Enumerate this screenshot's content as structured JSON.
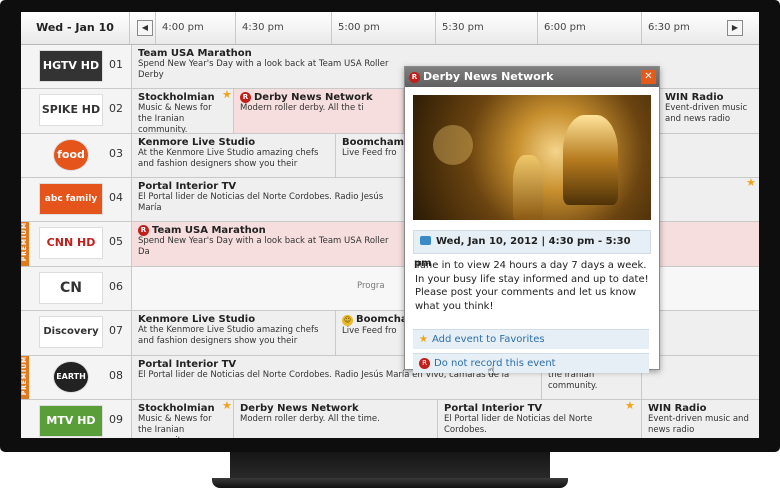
{
  "header": {
    "date": "Wed - Jan 10",
    "prev": "◀",
    "next": "▶",
    "times": [
      "4:00 pm",
      "4:30 pm",
      "5:00 pm",
      "5:30 pm",
      "6:00 pm",
      "6:30 pm"
    ]
  },
  "rows": [
    {
      "num": "01",
      "logo": "HGTV HD",
      "programs": [
        {
          "title": "Team USA Marathon",
          "desc": "Spend New Year's Day with a look back at Team USA Roller Derby"
        }
      ]
    },
    {
      "num": "02",
      "logo": "SPIKE HD",
      "programs": [
        {
          "title": "Stockholmian",
          "desc": "Music & News for the Iranian community."
        },
        {
          "title": "Derby News Network",
          "desc": "Modern roller derby. All the ti"
        },
        {
          "title": "WIN Radio",
          "desc": "Event-driven music and news radio"
        }
      ]
    },
    {
      "num": "03",
      "logo": "food HD",
      "programs": [
        {
          "title": "Kenmore Live Studio",
          "desc": "At the Kenmore Live Studio amazing chefs and fashion designers show you their"
        },
        {
          "title": "Boomchamp",
          "desc": "Live Feed fro"
        }
      ]
    },
    {
      "num": "04",
      "logo": "abc family HD",
      "programs": [
        {
          "title": "Portal Interior TV",
          "desc": "El Portal lider de Noticias del Norte Cordobes. Radio Jesús María"
        }
      ]
    },
    {
      "num": "05",
      "logo": "CNN HD",
      "premium": "PREMIUM",
      "programs": [
        {
          "title": "Team USA Marathon",
          "desc": "Spend New Year's Day with a look back at Team USA Roller Da"
        }
      ]
    },
    {
      "num": "06",
      "logo": "CN",
      "programs": [
        {
          "title": "Progra",
          "desc": ""
        }
      ]
    },
    {
      "num": "07",
      "logo": "Discovery HD",
      "programs": [
        {
          "title": "Kenmore Live Studio",
          "desc": "At the Kenmore Live Studio amazing chefs and fashion designers show you their"
        },
        {
          "title": "Boomcha",
          "desc": "Live Feed fro"
        }
      ]
    },
    {
      "num": "08",
      "logo": "EARTH",
      "premium": "PREMIUM",
      "programs": [
        {
          "title": "Portal Interior TV",
          "desc": "El Portal lider de Noticias del Norte Cordobes. Radio Jesús María en Vivo, camaras de la"
        },
        {
          "title": "",
          "desc": "Music & News for the Iranian community."
        }
      ]
    },
    {
      "num": "09",
      "logo": "MTV HD",
      "programs": [
        {
          "title": "Stockholmian",
          "desc": "Music & News for the Iranian community."
        },
        {
          "title": "Derby News Network",
          "desc": "Modern roller derby. All the time."
        },
        {
          "title": "Portal Interior TV",
          "desc": "El Portal lider de Noticias del Norte Cordobes."
        },
        {
          "title": "WIN Radio",
          "desc": "Event-driven music and news radio"
        }
      ]
    }
  ],
  "popup": {
    "title": "Derby News Network",
    "close": "✕",
    "datetime": "Wed, Jan 10, 2012 | 4:30 pm - 5:30 pm",
    "description": "Tune in to view 24 hours a day 7 days a week. In your busy life stay informed and up to date! Please post your comments and let us know what you think!",
    "action_favorite": "Add event to Favorites",
    "action_record": "Do not record this event"
  },
  "icons": {
    "record": "R",
    "star": "★",
    "smiley": "☺",
    "cursor": "☝"
  },
  "colors": {
    "pink": "#f6dede",
    "orange": "#e07a1f",
    "close": "#e25b1b",
    "link": "#2d6ea8"
  }
}
